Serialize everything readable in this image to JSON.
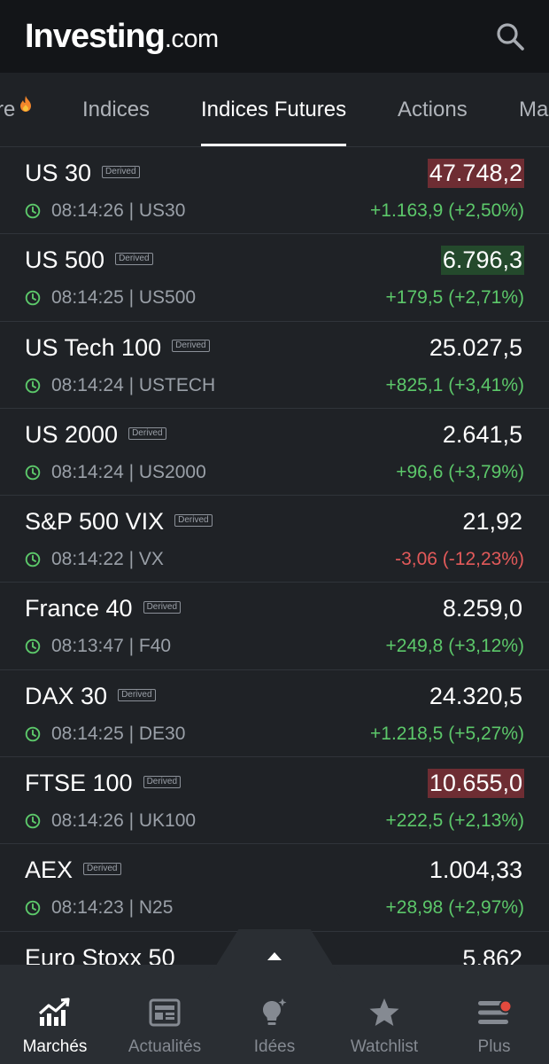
{
  "header": {
    "logo_main": "Investing",
    "logo_sub": ".com",
    "search_icon": "search-icon"
  },
  "tabs": [
    {
      "label": "re",
      "fire": true
    },
    {
      "label": "Indices"
    },
    {
      "label": "Indices Futures",
      "active": true
    },
    {
      "label": "Actions"
    },
    {
      "label": "Ma"
    }
  ],
  "rows": [
    {
      "name": "US 30",
      "badge": "Derived",
      "time": "08:14:26 | US30",
      "price": "47.748,2",
      "change": "+1.163,9 (+2,50%)",
      "dir": "up",
      "highlight": "down"
    },
    {
      "name": "US 500",
      "badge": "Derived",
      "time": "08:14:25 | US500",
      "price": "6.796,3",
      "change": "+179,5 (+2,71%)",
      "dir": "up",
      "highlight": "up"
    },
    {
      "name": "US Tech 100",
      "badge": "Derived",
      "time": "08:14:24 | USTECH",
      "price": "25.027,5",
      "change": "+825,1 (+3,41%)",
      "dir": "up",
      "highlight": ""
    },
    {
      "name": "US 2000",
      "badge": "Derived",
      "time": "08:14:24 | US2000",
      "price": "2.641,5",
      "change": "+96,6 (+3,79%)",
      "dir": "up",
      "highlight": ""
    },
    {
      "name": "S&P 500 VIX",
      "badge": "Derived",
      "time": "08:14:22 | VX",
      "price": "21,92",
      "change": "-3,06 (-12,23%)",
      "dir": "down",
      "highlight": ""
    },
    {
      "name": "France 40",
      "badge": "Derived",
      "time": "08:13:47 | F40",
      "price": "8.259,0",
      "change": "+249,8 (+3,12%)",
      "dir": "up",
      "highlight": ""
    },
    {
      "name": "DAX 30",
      "badge": "Derived",
      "time": "08:14:25 | DE30",
      "price": "24.320,5",
      "change": "+1.218,5 (+5,27%)",
      "dir": "up",
      "highlight": ""
    },
    {
      "name": "FTSE 100",
      "badge": "Derived",
      "time": "08:14:26 | UK100",
      "price": "10.655,0",
      "change": "+222,5 (+2,13%)",
      "dir": "up",
      "highlight": "down"
    },
    {
      "name": "AEX",
      "badge": "Derived",
      "time": "08:14:23 | N25",
      "price": "1.004,33",
      "change": "+28,98 (+2,97%)",
      "dir": "up",
      "highlight": ""
    }
  ],
  "partial_row": {
    "name": "Euro Stoxx 50",
    "price": "5.862"
  },
  "bottom_nav": [
    {
      "label": "Marchés",
      "icon": "chart-trend-icon",
      "active": true
    },
    {
      "label": "Actualités",
      "icon": "newspaper-icon"
    },
    {
      "label": "Idées",
      "icon": "lightbulb-icon"
    },
    {
      "label": "Watchlist",
      "icon": "star-icon"
    },
    {
      "label": "Plus",
      "icon": "menu-icon",
      "notification": true
    }
  ],
  "colors": {
    "up": "#5cc86a",
    "down": "#e35a5a",
    "bg": "#1f2226",
    "header_bg": "#131518",
    "nav_bg": "#2a2e33"
  }
}
